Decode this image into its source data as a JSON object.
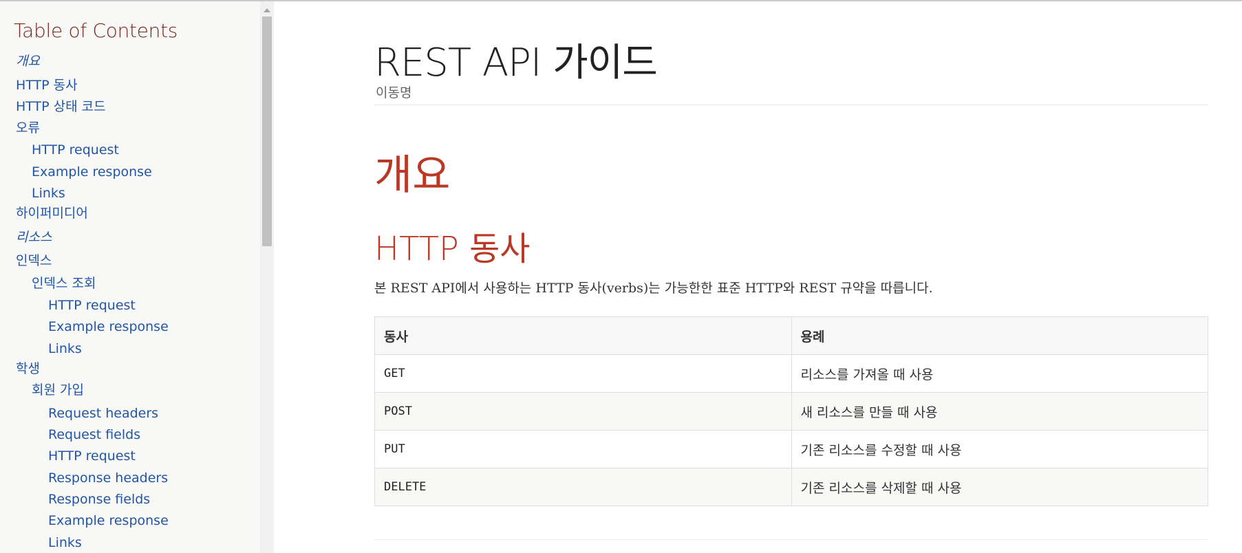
{
  "toc": {
    "title": "Table of Contents",
    "items": [
      {
        "label": "개요",
        "italic": true
      },
      {
        "label": "HTTP 동사"
      },
      {
        "label": "HTTP 상태 코드"
      },
      {
        "label": "오류"
      },
      {
        "label": "HTTP request"
      },
      {
        "label": "Example response"
      },
      {
        "label": "Links"
      },
      {
        "label": "하이퍼미디어"
      },
      {
        "label": "리소스",
        "italic": true
      },
      {
        "label": "인덱스"
      },
      {
        "label": "인덱스 조회"
      },
      {
        "label": "HTTP request"
      },
      {
        "label": "Example response"
      },
      {
        "label": "Links"
      },
      {
        "label": "학생"
      },
      {
        "label": "회원 가입"
      },
      {
        "label": "Request headers"
      },
      {
        "label": "Request fields"
      },
      {
        "label": "HTTP request"
      },
      {
        "label": "Response headers"
      },
      {
        "label": "Response fields"
      },
      {
        "label": "Example response"
      },
      {
        "label": "Links"
      }
    ]
  },
  "doc": {
    "title": "REST API 가이드",
    "author": "이동명"
  },
  "overview": {
    "heading": "개요",
    "verbs_heading": "HTTP 동사",
    "verbs_intro": "본 REST API에서 사용하는 HTTP 동사(verbs)는 가능한한 표준 HTTP와 REST 규약을 따릅니다."
  },
  "verbs_table": {
    "headers": [
      "동사",
      "용례"
    ],
    "rows": [
      {
        "verb": "GET",
        "usage": "리소스를 가져올 때 사용"
      },
      {
        "verb": "POST",
        "usage": "새 리소스를 만들 때 사용"
      },
      {
        "verb": "PUT",
        "usage": "기존 리소스를 수정할 때 사용"
      },
      {
        "verb": "DELETE",
        "usage": "기존 리소스를 삭제할 때 사용"
      }
    ]
  },
  "colors": {
    "link": "#2156a5",
    "heading": "#ba3925",
    "toc_title": "#7a2518",
    "toc_background": "#f8f8f7"
  }
}
